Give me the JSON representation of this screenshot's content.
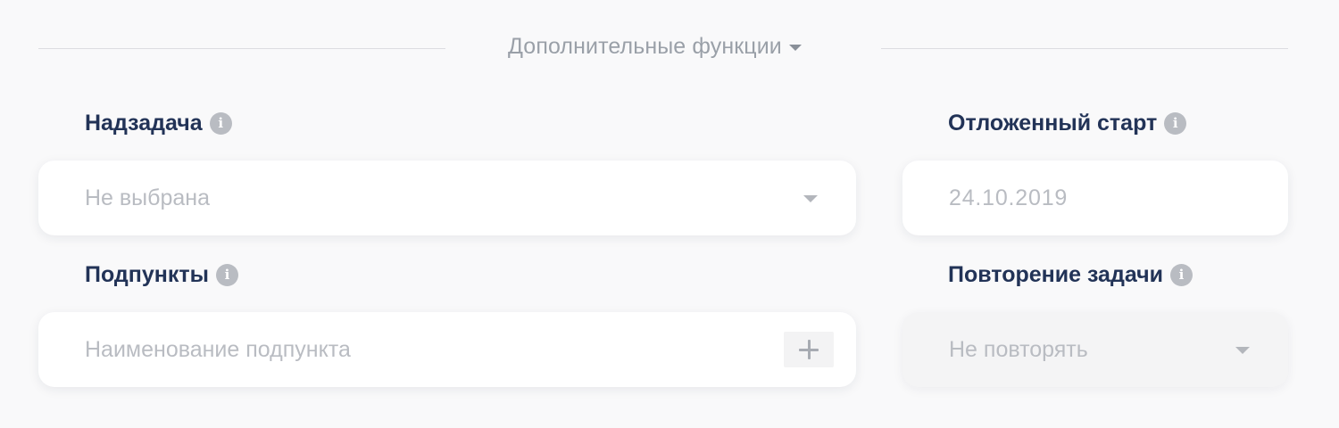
{
  "section": {
    "toggle_label": "Дополнительные функции",
    "expanded": true
  },
  "parent_task": {
    "label": "Надзадача",
    "selected_value": "Не выбрана"
  },
  "delayed_start": {
    "label": "Отложенный старт",
    "date_value": "24.10.2019"
  },
  "subitems": {
    "label": "Подпункты",
    "placeholder": "Наименование подпункта"
  },
  "repeat": {
    "label": "Повторение задачи",
    "selected_value": "Не повторять",
    "disabled": true
  },
  "icons": {
    "info": "info-icon",
    "caret": "chevron-down-icon",
    "add": "plus-icon"
  },
  "colors": {
    "label": "#223357",
    "muted_text": "#b9bcc2",
    "background": "#f9f9fa",
    "info_icon": "#b9bcc2"
  }
}
